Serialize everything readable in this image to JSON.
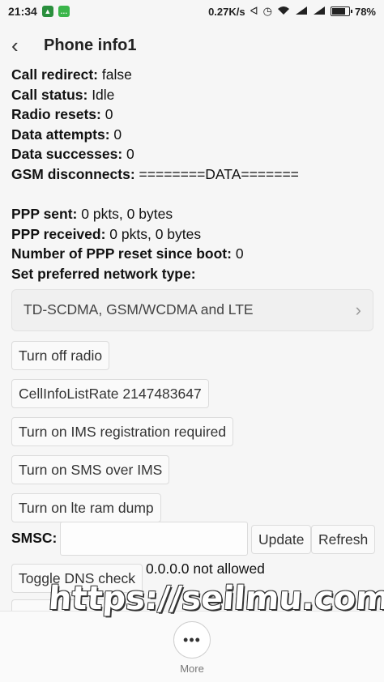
{
  "status_bar": {
    "time": "21:34",
    "notif_icons": [
      "shield-icon",
      "chat-icon"
    ],
    "net_speed": "0.27K/s",
    "right_icons": [
      "bluetooth-icon",
      "alarm-icon",
      "wifi-icon",
      "signal-icon",
      "signal-icon"
    ],
    "battery_level_fraction": 0.78,
    "battery_text": "78%"
  },
  "header": {
    "back_icon": "chevron-left-icon",
    "title": "Phone info1"
  },
  "info_rows": [
    {
      "label": "Call redirect:",
      "value": " false"
    },
    {
      "label": "Call status:",
      "value": " Idle"
    },
    {
      "label": "Radio resets:",
      "value": " 0"
    },
    {
      "label": "Data attempts:",
      "value": " 0"
    },
    {
      "label": "Data successes:",
      "value": " 0"
    },
    {
      "label": "GSM disconnects:",
      "value": " ========DATA======="
    }
  ],
  "ppp_rows": [
    {
      "label": "PPP sent:",
      "value": " 0 pkts, 0 bytes"
    },
    {
      "label": "PPP received:",
      "value": " 0 pkts, 0 bytes"
    },
    {
      "label": "Number of PPP reset since boot:",
      "value": " 0"
    }
  ],
  "network_type": {
    "label": "Set preferred network type:",
    "selected": "TD-SCDMA, GSM/WCDMA and LTE"
  },
  "buttons": {
    "radio": "Turn off radio",
    "cellinfo": "CellInfoListRate 2147483647",
    "ims_reg": "Turn on IMS registration required",
    "sms_ims": "Turn on SMS over IMS",
    "lte_dump": "Turn on lte ram dump",
    "update": "Update",
    "refresh": "Refresh",
    "dns": "Toggle DNS check"
  },
  "smsc": {
    "label": "SMSC:",
    "value": ""
  },
  "dns_status": "0.0.0.0 not allowed",
  "bottom": {
    "more_icon": "more-dots-icon",
    "more_label": "More"
  },
  "watermark": "https://seilmu.com"
}
